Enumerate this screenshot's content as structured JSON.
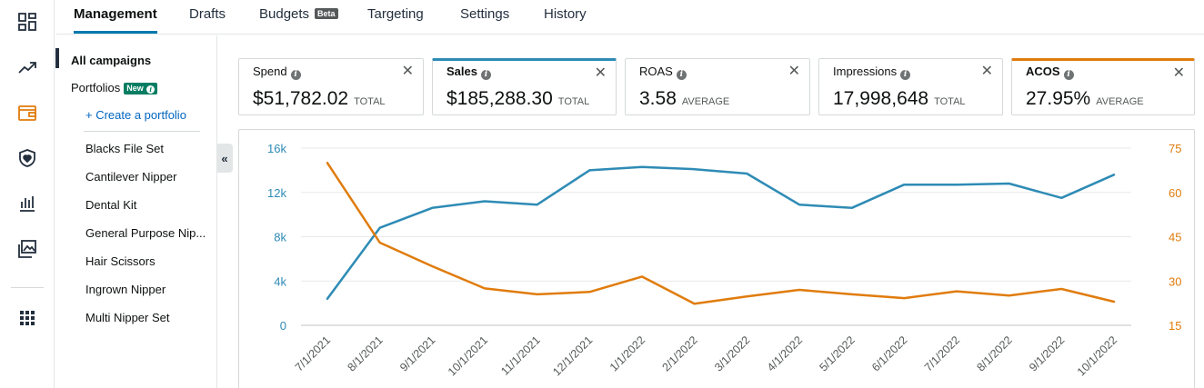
{
  "rail": {
    "icons": [
      "dashboard-icon",
      "trending-up-icon",
      "wallet-icon",
      "shield-heart-icon",
      "bar-chart-icon",
      "image-gallery-icon",
      "apps-grid-icon"
    ],
    "active_color": "#e07c0d"
  },
  "tabs": [
    {
      "label": "Management",
      "active": true
    },
    {
      "label": "Drafts"
    },
    {
      "label": "Budgets",
      "badge": "Beta"
    },
    {
      "label": "Targeting"
    },
    {
      "label": "Settings"
    },
    {
      "label": "History"
    }
  ],
  "sidebar": {
    "all_campaigns": "All campaigns",
    "portfolios": "Portfolios",
    "new_badge": "New",
    "create_portfolio": "+ Create a portfolio",
    "portfolio_items": [
      "Blacks File Set",
      "Cantilever Nipper",
      "Dental Kit",
      "General Purpose Nip...",
      "Hair Scissors",
      "Ingrown Nipper",
      "Multi Nipper Set"
    ],
    "collapse_glyph": "«"
  },
  "metrics": [
    {
      "label": "Spend",
      "value": "$51,782.02",
      "unit": "TOTAL",
      "selected": false
    },
    {
      "label": "Sales",
      "value": "$185,288.30",
      "unit": "TOTAL",
      "selected": true,
      "color": "#2e8bb5"
    },
    {
      "label": "ROAS",
      "value": "3.58",
      "unit": "AVERAGE",
      "selected": false
    },
    {
      "label": "Impressions",
      "value": "17,998,648",
      "unit": "TOTAL",
      "selected": false
    },
    {
      "label": "ACOS",
      "value": "27.95%",
      "unit": "AVERAGE",
      "selected": true,
      "color": "#e07c0d"
    }
  ],
  "chart_data": {
    "type": "line",
    "x": [
      "7/1/2021",
      "8/1/2021",
      "9/1/2021",
      "10/1/2021",
      "11/1/2021",
      "12/1/2021",
      "1/1/2022",
      "2/1/2022",
      "3/1/2022",
      "4/1/2022",
      "5/1/2022",
      "6/1/2022",
      "7/1/2022",
      "8/1/2022",
      "9/1/2022",
      "10/1/2022"
    ],
    "series": [
      {
        "name": "Sales",
        "axis": "left",
        "color": "#2e8bb5",
        "values": [
          2400,
          8800,
          10600,
          11200,
          10900,
          14000,
          14300,
          14100,
          13700,
          10900,
          10600,
          12700,
          12700,
          12800,
          11500,
          13600
        ]
      },
      {
        "name": "ACOS",
        "axis": "right",
        "color": "#e07c0d",
        "values": [
          70,
          43,
          35,
          27.5,
          25.5,
          26.3,
          31.5,
          22.3,
          24.8,
          27,
          25.5,
          24.2,
          26.5,
          25.1,
          27.3,
          23
        ]
      }
    ],
    "y_left": {
      "ticks": [
        "0",
        "4k",
        "8k",
        "12k",
        "16k"
      ],
      "values": [
        0,
        4000,
        8000,
        12000,
        16000
      ],
      "ylim": [
        0,
        16000
      ],
      "color": "#2e8bb5"
    },
    "y_right": {
      "ticks": [
        "15",
        "30",
        "45",
        "60",
        "75"
      ],
      "values": [
        15,
        30,
        45,
        60,
        75
      ],
      "ylim": [
        15,
        75
      ],
      "color": "#e07c0d"
    },
    "grid": true
  }
}
